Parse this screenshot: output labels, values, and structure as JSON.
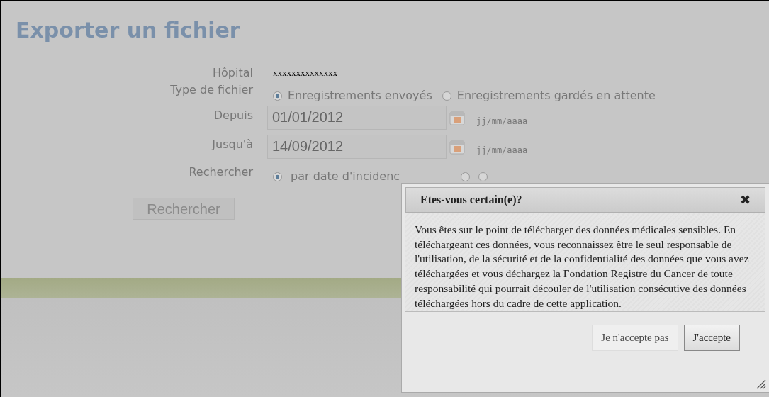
{
  "page": {
    "title": "Exporter un fichier"
  },
  "form": {
    "hospital_label": "Hôpital",
    "hospital_value": "xxxxxxxxxxxxxx",
    "file_type_label": "Type de fichier",
    "file_types": [
      {
        "label": "Enregistrements envoyés",
        "selected": true
      },
      {
        "label": "Enregistrements gardés en attente",
        "selected": false
      }
    ],
    "dates": [
      {
        "label": "Depuis",
        "value": "01/01/2012",
        "hint": "jj/mm/aaaa"
      },
      {
        "label": "Jusqu'à",
        "value": "14/09/2012",
        "hint": "jj/mm/aaaa"
      }
    ],
    "search_label": "Rechercher",
    "search_by": [
      {
        "label": "par date d'incidenc",
        "selected": true
      },
      {
        "selected": false
      },
      {
        "selected": false
      }
    ],
    "search_button": "Rechercher"
  },
  "dialog": {
    "title": "Etes-vous certain(e)?",
    "close": "✖",
    "message": "Vous êtes sur le point de télécharger des données médicales sensibles. En téléchargeant ces données, vous reconnaissez être le seul responsable de l'utilisation, de la sécurité et de la confidentialité des données que vous avez téléchargées et vous déchargez la Fondation Registre du Cancer de toute responsabilité qui pourrait découler de l'utilisation consécutive des données téléchargées hors du cadre de cette application.",
    "buttons": [
      "Je n'accepte pas",
      "J'accepte"
    ]
  }
}
